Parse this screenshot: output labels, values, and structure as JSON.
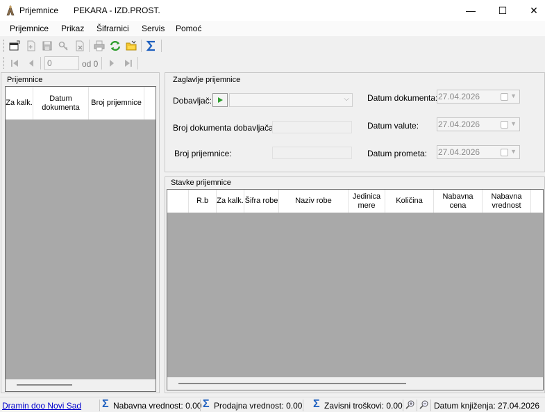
{
  "window": {
    "title": "Prijemnice",
    "company": "PEKARA - IZD.PROST.",
    "minimize": "—",
    "maximize": "☐",
    "close": "✕"
  },
  "menu": [
    "Prijemnice",
    "Prikaz",
    "Šifrarnici",
    "Servis",
    "Pomoć"
  ],
  "toolbar": {
    "icons": [
      "new-window-icon",
      "new-document-icon",
      "save-icon",
      "key-icon",
      "delete-icon",
      "print-icon",
      "refresh-icon",
      "open-folder-icon",
      "sigma-icon"
    ]
  },
  "navigator": {
    "position": "0",
    "of_label": "od 0"
  },
  "left_panel": {
    "title": "Prijemnice",
    "columns": [
      "Za kalk.",
      "Datum dokumenta",
      "Broj prijemnice"
    ]
  },
  "header": {
    "title": "Zaglavlje prijemnice",
    "dobavljac_label": "Dobavljač:",
    "broj_dok_dobavljaca_label": "Broj dokumenta dobavljača:",
    "broj_prijemnice_label": "Broj prijemnice:",
    "datum_dokumenta_label": "Datum dokumenta:",
    "datum_valute_label": "Datum valute:",
    "datum_prometa_label": "Datum prometa:",
    "datum_dokumenta": "27.04.2026",
    "datum_valute": "27.04.2026",
    "datum_prometa": "27.04.2026"
  },
  "items": {
    "title": "Stavke prijemnice",
    "columns": [
      "R.b",
      "Za kalk.",
      "Šifra robe",
      "Naziv robe",
      "Jedinica mere",
      "Količina",
      "Nabavna cena",
      "Nabavna vrednost"
    ]
  },
  "status": {
    "company_link": "Dramin doo Novi Sad",
    "nabavna": "Nabavna vrednost: 0.00",
    "prodajna": "Prodajna vrednost: 0.00",
    "zavisni": "Zavisni troškovi: 0.00",
    "datum_knjizenja": "Datum knjiženja: 27.04.2026"
  },
  "colors": {
    "grid_background": "#a9a9a9",
    "sigma": "#1d5fbf",
    "play_green": "#2e9e2e",
    "link": "#0000cc"
  }
}
